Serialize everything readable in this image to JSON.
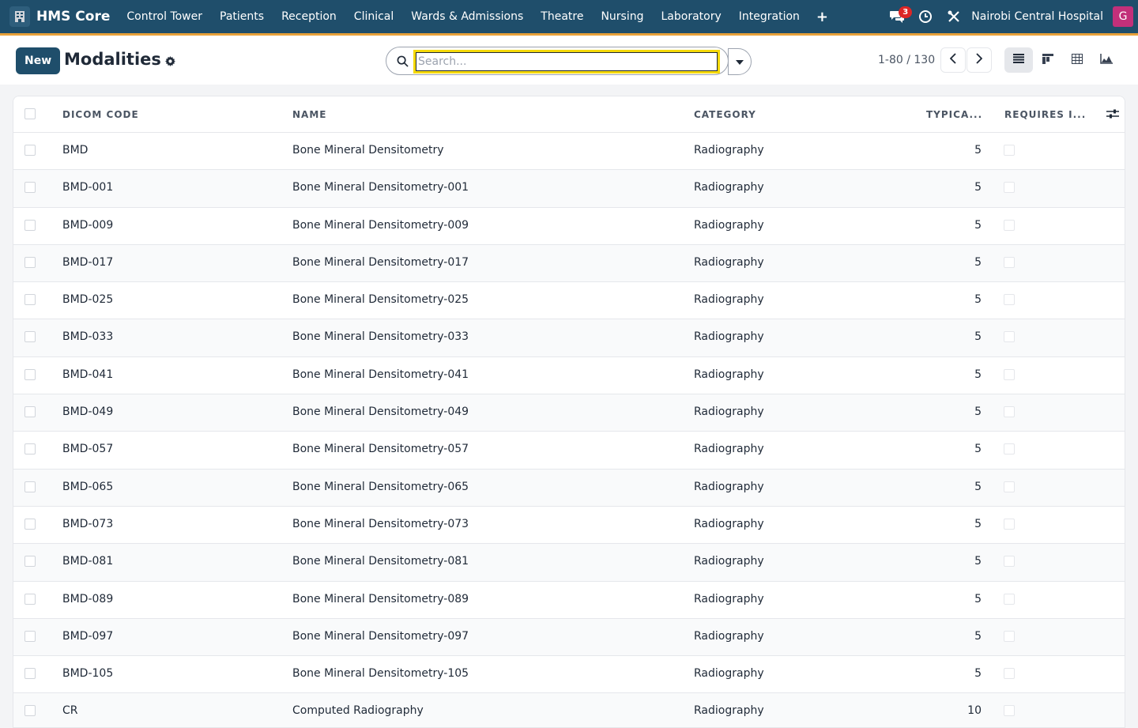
{
  "navbar": {
    "app_name": "HMS Core",
    "menu": [
      "Control Tower",
      "Patients",
      "Reception",
      "Clinical",
      "Wards & Admissions",
      "Theatre",
      "Nursing",
      "Laboratory",
      "Integration"
    ],
    "plus_label": "+",
    "message_count": "3",
    "company": "Nairobi Central Hospital",
    "avatar_initial": "G"
  },
  "control": {
    "new_label": "New",
    "title": "Modalities",
    "search_placeholder": "Search...",
    "pager": "1-80 / 130"
  },
  "list": {
    "columns": [
      "DICOM CODE",
      "NAME",
      "CATEGORY",
      "TYPICA...",
      "REQUIRES I..."
    ],
    "rows": [
      {
        "code": "BMD",
        "name": "Bone Mineral Densitometry",
        "category": "Radiography",
        "typical": "5"
      },
      {
        "code": "BMD-001",
        "name": "Bone Mineral Densitometry-001",
        "category": "Radiography",
        "typical": "5"
      },
      {
        "code": "BMD-009",
        "name": "Bone Mineral Densitometry-009",
        "category": "Radiography",
        "typical": "5"
      },
      {
        "code": "BMD-017",
        "name": "Bone Mineral Densitometry-017",
        "category": "Radiography",
        "typical": "5"
      },
      {
        "code": "BMD-025",
        "name": "Bone Mineral Densitometry-025",
        "category": "Radiography",
        "typical": "5"
      },
      {
        "code": "BMD-033",
        "name": "Bone Mineral Densitometry-033",
        "category": "Radiography",
        "typical": "5"
      },
      {
        "code": "BMD-041",
        "name": "Bone Mineral Densitometry-041",
        "category": "Radiography",
        "typical": "5"
      },
      {
        "code": "BMD-049",
        "name": "Bone Mineral Densitometry-049",
        "category": "Radiography",
        "typical": "5"
      },
      {
        "code": "BMD-057",
        "name": "Bone Mineral Densitometry-057",
        "category": "Radiography",
        "typical": "5"
      },
      {
        "code": "BMD-065",
        "name": "Bone Mineral Densitometry-065",
        "category": "Radiography",
        "typical": "5"
      },
      {
        "code": "BMD-073",
        "name": "Bone Mineral Densitometry-073",
        "category": "Radiography",
        "typical": "5"
      },
      {
        "code": "BMD-081",
        "name": "Bone Mineral Densitometry-081",
        "category": "Radiography",
        "typical": "5"
      },
      {
        "code": "BMD-089",
        "name": "Bone Mineral Densitometry-089",
        "category": "Radiography",
        "typical": "5"
      },
      {
        "code": "BMD-097",
        "name": "Bone Mineral Densitometry-097",
        "category": "Radiography",
        "typical": "5"
      },
      {
        "code": "BMD-105",
        "name": "Bone Mineral Densitometry-105",
        "category": "Radiography",
        "typical": "5"
      },
      {
        "code": "CR",
        "name": "Computed Radiography",
        "category": "Radiography",
        "typical": "10"
      }
    ]
  },
  "colors": {
    "navbar_bg": "#1f4e6b",
    "navbar_accent": "#e8a13a",
    "primary": "#1f4e6b",
    "badge": "#dc2626",
    "avatar": "#c2307a",
    "search_focus": "#f5d90a"
  },
  "icons": {
    "app_logo": "hospital-icon",
    "messages": "chat-icon",
    "activity": "clock-icon",
    "debug": "tools-icon",
    "title_action": "gear-icon",
    "search": "search-icon",
    "search_toggle": "caret-down-icon",
    "pager_prev": "chevron-left-icon",
    "pager_next": "chevron-right-icon",
    "view_list": "list-icon",
    "view_kanban": "kanban-icon",
    "view_pivot": "pivot-icon",
    "view_graph": "graph-icon",
    "optional_columns": "sliders-icon"
  }
}
